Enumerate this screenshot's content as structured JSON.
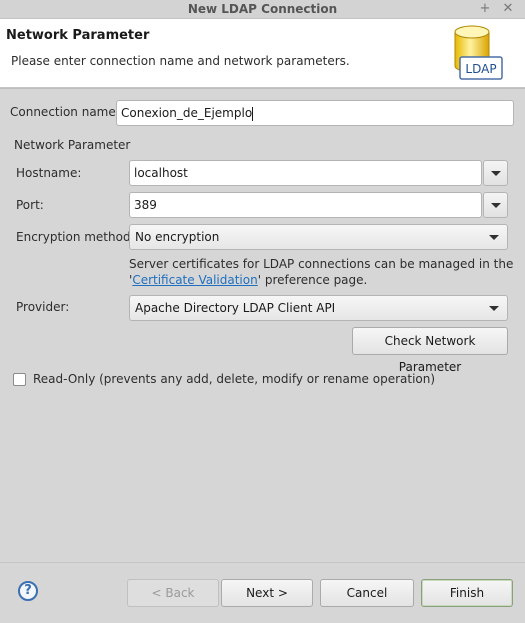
{
  "window": {
    "title": "New LDAP Connection",
    "maximize_glyph": "+",
    "close_glyph": "✕"
  },
  "banner": {
    "title": "Network Parameter",
    "message": "Please enter connection name and network parameters.",
    "logo_text": "LDAP"
  },
  "form": {
    "connection_name_label": "Connection name:",
    "connection_name_value": "Conexion_de_Ejemplo",
    "group_title": "Network Parameter",
    "hostname_label": "Hostname:",
    "hostname_value": "localhost",
    "port_label": "Port:",
    "port_value": "389",
    "encryption_label": "Encryption method:",
    "encryption_value": "No encryption",
    "cert_note_line1": "Server certificates for LDAP connections can be managed in the",
    "cert_note_prefix": "'",
    "cert_link": "Certificate Validation",
    "cert_note_suffix": "' preference page.",
    "provider_label": "Provider:",
    "provider_value": "Apache Directory LDAP Client API",
    "check_button": "Check Network Parameter",
    "readonly_label": "Read-Only (prevents any add, delete, modify or rename operation)",
    "readonly_checked": false
  },
  "footer": {
    "help_glyph": "?",
    "back": "< Back",
    "next": "Next >",
    "cancel": "Cancel",
    "finish": "Finish"
  },
  "icons": {
    "help": "help-icon",
    "dropdown": "chevron-down-icon",
    "logo": "ldap-database-icon"
  },
  "colors": {
    "link": "#1f6fbf",
    "dialog_background": "#d6d6d6",
    "banner_background": "#ffffff",
    "help_icon": "#3a70b0"
  }
}
